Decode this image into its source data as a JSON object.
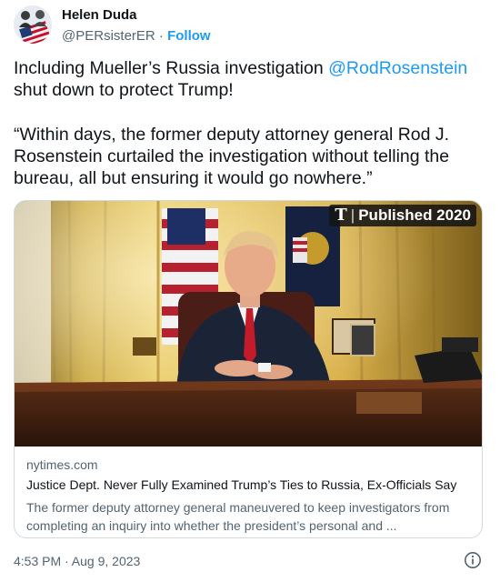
{
  "author": {
    "name": "Helen Duda",
    "handle": "@PERsisterER",
    "separator": " · ",
    "follow_label": "Follow"
  },
  "tweet": {
    "text_part1": "Including Mueller’s Russia investigation ",
    "mention": "@RodRosenstein",
    "text_part1_end": " shut down to protect Trump!",
    "paragraph2": "“Within days, the former deputy attorney general Rod J. Rosenstein curtailed the investigation without telling the bureau, all but ensuring it would go nowhere.”"
  },
  "card": {
    "badge_logo": "T",
    "badge_separator": "|",
    "badge_text": "Published 2020",
    "domain": "nytimes.com",
    "title": "Justice Dept. Never Fully Examined Trump’s Ties to Russia, Ex-Officials Say",
    "description": "The former deputy attorney general maneuvered to keep investigators from completing an inquiry into whether the president’s personal and ..."
  },
  "footer": {
    "timestamp": "4:53 PM · Aug 9, 2023"
  },
  "colors": {
    "accent": "#1d9bf0",
    "secondary_text": "#536471",
    "border": "#cfd9de"
  },
  "icons": [
    "avatar-image",
    "info-icon"
  ]
}
